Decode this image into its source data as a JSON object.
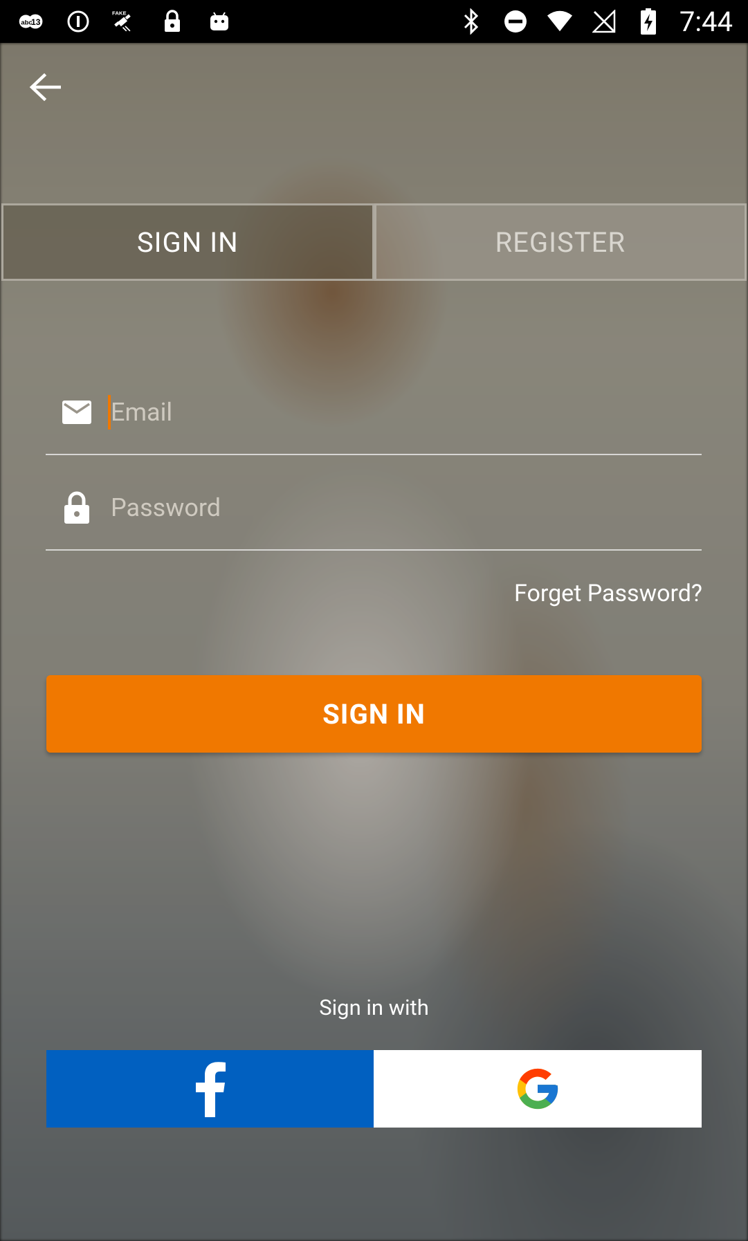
{
  "status_bar": {
    "time": "7:44",
    "left_icons": [
      "abc13-icon",
      "info-icon",
      "fake-gps-icon",
      "lock-icon",
      "android-icon"
    ],
    "right_icons": [
      "bluetooth-icon",
      "do-not-disturb-icon",
      "wifi-icon",
      "no-signal-icon",
      "battery-charging-icon"
    ]
  },
  "tabs": [
    {
      "label": "SIGN IN",
      "active": true
    },
    {
      "label": "REGISTER",
      "active": false
    }
  ],
  "form": {
    "email_placeholder": "Email",
    "password_placeholder": "Password",
    "forgot_label": "Forget Password?",
    "submit_label": "SIGN IN"
  },
  "social": {
    "heading": "Sign in with",
    "providers": [
      "facebook",
      "google"
    ]
  },
  "colors": {
    "accent": "#f07800",
    "facebook": "#0160c0",
    "google_bg": "#ffffff"
  }
}
